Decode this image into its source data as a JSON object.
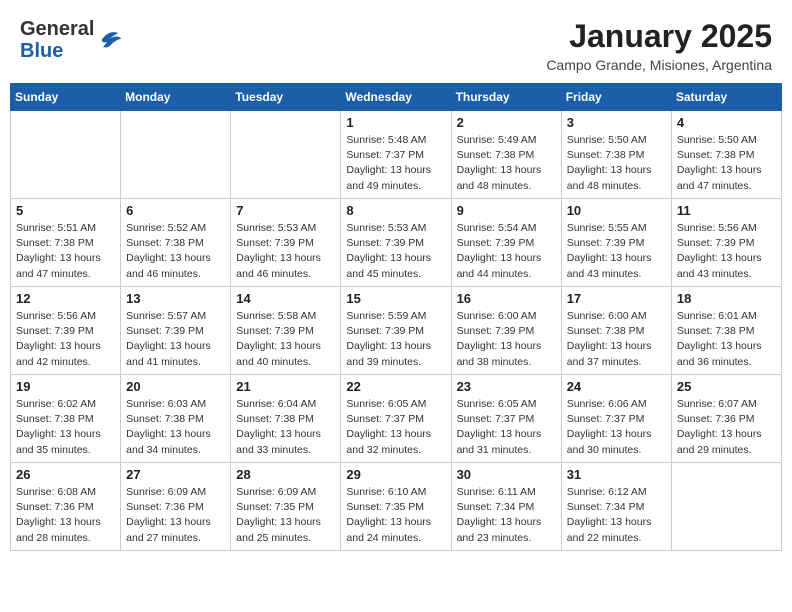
{
  "header": {
    "logo_text_general": "General",
    "logo_text_blue": "Blue",
    "month_year": "January 2025",
    "location": "Campo Grande, Misiones, Argentina"
  },
  "weekdays": [
    "Sunday",
    "Monday",
    "Tuesday",
    "Wednesday",
    "Thursday",
    "Friday",
    "Saturday"
  ],
  "weeks": [
    {
      "days": [
        {
          "date": "",
          "detail": ""
        },
        {
          "date": "",
          "detail": ""
        },
        {
          "date": "",
          "detail": ""
        },
        {
          "date": "1",
          "detail": "Sunrise: 5:48 AM\nSunset: 7:37 PM\nDaylight: 13 hours\nand 49 minutes."
        },
        {
          "date": "2",
          "detail": "Sunrise: 5:49 AM\nSunset: 7:38 PM\nDaylight: 13 hours\nand 48 minutes."
        },
        {
          "date": "3",
          "detail": "Sunrise: 5:50 AM\nSunset: 7:38 PM\nDaylight: 13 hours\nand 48 minutes."
        },
        {
          "date": "4",
          "detail": "Sunrise: 5:50 AM\nSunset: 7:38 PM\nDaylight: 13 hours\nand 47 minutes."
        }
      ]
    },
    {
      "days": [
        {
          "date": "5",
          "detail": "Sunrise: 5:51 AM\nSunset: 7:38 PM\nDaylight: 13 hours\nand 47 minutes."
        },
        {
          "date": "6",
          "detail": "Sunrise: 5:52 AM\nSunset: 7:38 PM\nDaylight: 13 hours\nand 46 minutes."
        },
        {
          "date": "7",
          "detail": "Sunrise: 5:53 AM\nSunset: 7:39 PM\nDaylight: 13 hours\nand 46 minutes."
        },
        {
          "date": "8",
          "detail": "Sunrise: 5:53 AM\nSunset: 7:39 PM\nDaylight: 13 hours\nand 45 minutes."
        },
        {
          "date": "9",
          "detail": "Sunrise: 5:54 AM\nSunset: 7:39 PM\nDaylight: 13 hours\nand 44 minutes."
        },
        {
          "date": "10",
          "detail": "Sunrise: 5:55 AM\nSunset: 7:39 PM\nDaylight: 13 hours\nand 43 minutes."
        },
        {
          "date": "11",
          "detail": "Sunrise: 5:56 AM\nSunset: 7:39 PM\nDaylight: 13 hours\nand 43 minutes."
        }
      ]
    },
    {
      "days": [
        {
          "date": "12",
          "detail": "Sunrise: 5:56 AM\nSunset: 7:39 PM\nDaylight: 13 hours\nand 42 minutes."
        },
        {
          "date": "13",
          "detail": "Sunrise: 5:57 AM\nSunset: 7:39 PM\nDaylight: 13 hours\nand 41 minutes."
        },
        {
          "date": "14",
          "detail": "Sunrise: 5:58 AM\nSunset: 7:39 PM\nDaylight: 13 hours\nand 40 minutes."
        },
        {
          "date": "15",
          "detail": "Sunrise: 5:59 AM\nSunset: 7:39 PM\nDaylight: 13 hours\nand 39 minutes."
        },
        {
          "date": "16",
          "detail": "Sunrise: 6:00 AM\nSunset: 7:39 PM\nDaylight: 13 hours\nand 38 minutes."
        },
        {
          "date": "17",
          "detail": "Sunrise: 6:00 AM\nSunset: 7:38 PM\nDaylight: 13 hours\nand 37 minutes."
        },
        {
          "date": "18",
          "detail": "Sunrise: 6:01 AM\nSunset: 7:38 PM\nDaylight: 13 hours\nand 36 minutes."
        }
      ]
    },
    {
      "days": [
        {
          "date": "19",
          "detail": "Sunrise: 6:02 AM\nSunset: 7:38 PM\nDaylight: 13 hours\nand 35 minutes."
        },
        {
          "date": "20",
          "detail": "Sunrise: 6:03 AM\nSunset: 7:38 PM\nDaylight: 13 hours\nand 34 minutes."
        },
        {
          "date": "21",
          "detail": "Sunrise: 6:04 AM\nSunset: 7:38 PM\nDaylight: 13 hours\nand 33 minutes."
        },
        {
          "date": "22",
          "detail": "Sunrise: 6:05 AM\nSunset: 7:37 PM\nDaylight: 13 hours\nand 32 minutes."
        },
        {
          "date": "23",
          "detail": "Sunrise: 6:05 AM\nSunset: 7:37 PM\nDaylight: 13 hours\nand 31 minutes."
        },
        {
          "date": "24",
          "detail": "Sunrise: 6:06 AM\nSunset: 7:37 PM\nDaylight: 13 hours\nand 30 minutes."
        },
        {
          "date": "25",
          "detail": "Sunrise: 6:07 AM\nSunset: 7:36 PM\nDaylight: 13 hours\nand 29 minutes."
        }
      ]
    },
    {
      "days": [
        {
          "date": "26",
          "detail": "Sunrise: 6:08 AM\nSunset: 7:36 PM\nDaylight: 13 hours\nand 28 minutes."
        },
        {
          "date": "27",
          "detail": "Sunrise: 6:09 AM\nSunset: 7:36 PM\nDaylight: 13 hours\nand 27 minutes."
        },
        {
          "date": "28",
          "detail": "Sunrise: 6:09 AM\nSunset: 7:35 PM\nDaylight: 13 hours\nand 25 minutes."
        },
        {
          "date": "29",
          "detail": "Sunrise: 6:10 AM\nSunset: 7:35 PM\nDaylight: 13 hours\nand 24 minutes."
        },
        {
          "date": "30",
          "detail": "Sunrise: 6:11 AM\nSunset: 7:34 PM\nDaylight: 13 hours\nand 23 minutes."
        },
        {
          "date": "31",
          "detail": "Sunrise: 6:12 AM\nSunset: 7:34 PM\nDaylight: 13 hours\nand 22 minutes."
        },
        {
          "date": "",
          "detail": ""
        }
      ]
    }
  ]
}
